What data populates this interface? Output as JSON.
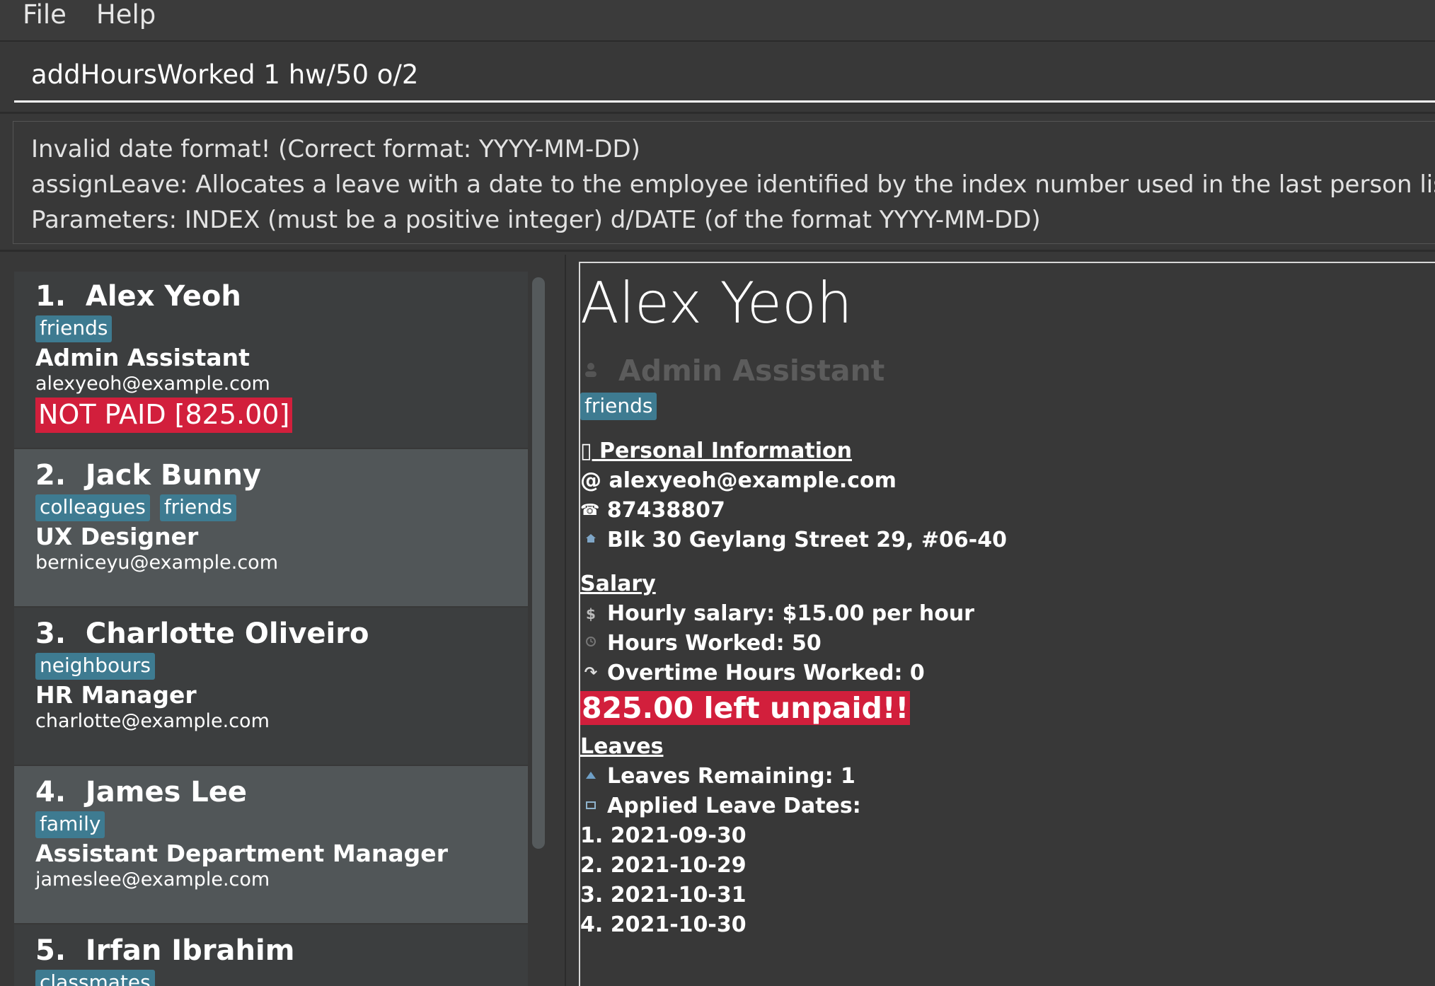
{
  "menu": {
    "file": "File",
    "help": "Help"
  },
  "command": {
    "value": "addHoursWorked 1 hw/50 o/2"
  },
  "result": {
    "lines": [
      "Invalid date format! (Correct format: YYYY-MM-DD)",
      "assignLeave: Allocates a leave with a date to the employee identified by the index number used in the last person listing.",
      "Parameters: INDEX (must be a positive integer) d/DATE (of the format YYYY-MM-DD)"
    ]
  },
  "persons": [
    {
      "index": "1.",
      "name": "Alex Yeoh",
      "tags": [
        "friends"
      ],
      "role": "Admin Assistant",
      "email": "alexyeoh@example.com",
      "badge": "NOT PAID [825.00]"
    },
    {
      "index": "2.",
      "name": "Jack Bunny",
      "tags": [
        "colleagues",
        "friends"
      ],
      "role": "UX Designer",
      "email": "berniceyu@example.com"
    },
    {
      "index": "3.",
      "name": "Charlotte Oliveiro",
      "tags": [
        "neighbours"
      ],
      "role": "HR Manager",
      "email": "charlotte@example.com"
    },
    {
      "index": "4.",
      "name": "James Lee",
      "tags": [
        "family"
      ],
      "role": "Assistant Department Manager",
      "email": "jameslee@example.com"
    },
    {
      "index": "5.",
      "name": "Irfan Ibrahim",
      "tags": [
        "classmates"
      ]
    }
  ],
  "detail": {
    "name": "Alex Yeoh",
    "role": "Admin Assistant",
    "tag": "friends",
    "personal_heading": "Personal Information",
    "personal_glyph": "▯",
    "email": "alexyeoh@example.com",
    "phone": "87438807",
    "address": "Blk 30 Geylang Street 29, #06-40",
    "salary_heading": "Salary",
    "hourly": "Hourly salary: $15.00 per hour",
    "hours": "Hours Worked: 50",
    "overtime": "Overtime Hours Worked: 0",
    "unpaid": "825.00 left unpaid!!",
    "leaves_heading": "Leaves",
    "leaves_remaining": "Leaves Remaining: 1",
    "applied_label": "Applied Leave Dates:",
    "leave_dates": [
      "1. 2021-09-30",
      "2. 2021-10-29",
      "3. 2021-10-31",
      "4. 2021-10-30"
    ],
    "icons": {
      "email": "@",
      "phone": "☎",
      "address": "home-icon",
      "dollar": "dollar-icon",
      "clock": "clock-icon",
      "overtime": "overtime-icon",
      "leave": "leave-icon",
      "calendar": "calendar-icon"
    }
  },
  "colors": {
    "background": "#383838",
    "tag": "#3e7b91",
    "unpaid": "#d21f3c",
    "card_alt": "#515658"
  }
}
